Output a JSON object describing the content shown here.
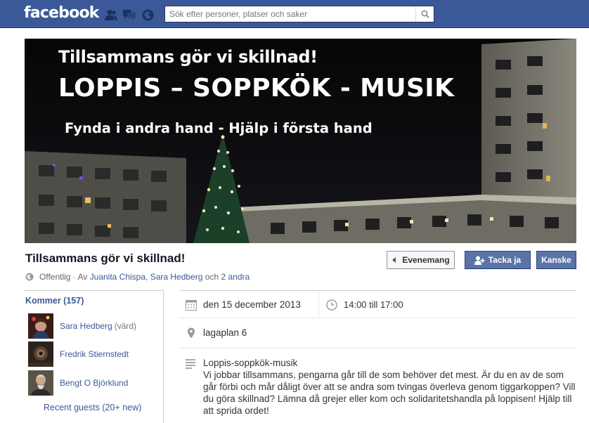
{
  "header": {
    "logo": "facebook",
    "search_placeholder": "Sök efter personer, platser och saker",
    "jewels": [
      "friend-requests-icon",
      "messages-icon",
      "notifications-icon"
    ]
  },
  "cover": {
    "line1": "Tillsammans gör vi skillnad!",
    "line2": "LOPPIS – SOPPKÖK - MUSIK",
    "line3": "Fynda i andra hand - Hjälp i första hand"
  },
  "event": {
    "title": "Tillsammans gör vi skillnad!",
    "privacy": "Offentlig",
    "by_prefix": "· Av",
    "host1": "Juanita Chispa",
    "host2": "Sara Hedberg",
    "and_word": "och",
    "others": "2 andra"
  },
  "buttons": {
    "events": "Evenemang",
    "join": "Tacka ja",
    "maybe": "Kanske"
  },
  "guests": {
    "going": "Kommer (157)",
    "list": [
      {
        "name": "Sara Hedberg",
        "role": "(värd)"
      },
      {
        "name": "Fredrik Stiernstedt",
        "role": ""
      },
      {
        "name": "Bengt O Björklund",
        "role": ""
      }
    ],
    "recent": "Recent guests (20+ new)"
  },
  "details": {
    "date": "den 15 december 2013",
    "time": "14:00 till 17:00",
    "place": "lagaplan 6",
    "desc_title": "Loppis-soppkök-musik",
    "desc_body": "Vi jobbar tillsammans, pengarna går till de som behöver det mest. Är du en av de som går förbi och mår dåligt över att se andra som tvingas överleva genom tiggarkoppen? Vill du göra skillnad? Lämna då grejer eller kom och solidaritetshandla på loppisen! Hjälp till att sprida ordet!"
  },
  "colors": {
    "brand": "#3b5998",
    "button_blue": "#5b74a8"
  }
}
